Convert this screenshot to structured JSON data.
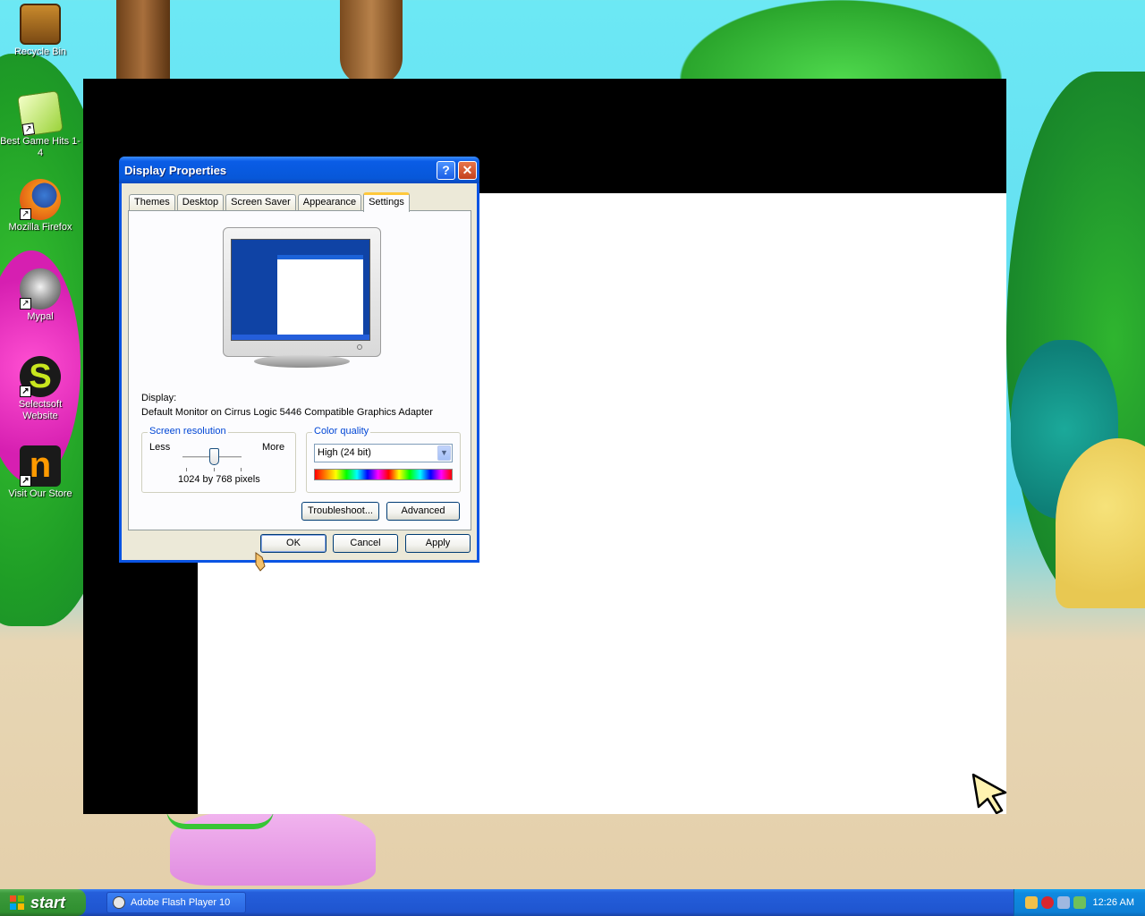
{
  "desktop": {
    "icons": [
      {
        "label": "Recycle Bin",
        "icon": "treasure-chest-icon"
      },
      {
        "label": "Best Game Hits 1-4",
        "icon": "dice-icon"
      },
      {
        "label": "Mozilla Firefox",
        "icon": "firefox-icon"
      },
      {
        "label": "Mypal",
        "icon": "raccoon-icon"
      },
      {
        "label": "Selectsoft Website",
        "icon": "selectsoft-s-icon"
      },
      {
        "label": "Visit Our Store",
        "icon": "store-n-icon"
      }
    ]
  },
  "dialog": {
    "title": "Display Properties",
    "tabs": [
      "Themes",
      "Desktop",
      "Screen Saver",
      "Appearance",
      "Settings"
    ],
    "active_tab": "Settings",
    "display_label": "Display:",
    "display_value": "Default Monitor on Cirrus Logic 5446 Compatible Graphics Adapter",
    "screen_resolution": {
      "legend": "Screen resolution",
      "less": "Less",
      "more": "More",
      "value": "1024 by 768 pixels",
      "slider_position": 0.5
    },
    "color_quality": {
      "legend": "Color quality",
      "selected": "High (24 bit)"
    },
    "buttons": {
      "troubleshoot": "Troubleshoot...",
      "advanced": "Advanced",
      "ok": "OK",
      "cancel": "Cancel",
      "apply": "Apply"
    }
  },
  "taskbar": {
    "start_label": "start",
    "task_item": "Adobe Flash Player 10",
    "clock": "12:26 AM"
  },
  "colors": {
    "titlebar_blue": "#0a54e3",
    "taskbar_blue": "#245edb",
    "start_green": "#3c9a3c",
    "tray_blue": "#0f8ae0",
    "dialog_face": "#ece9d8"
  }
}
